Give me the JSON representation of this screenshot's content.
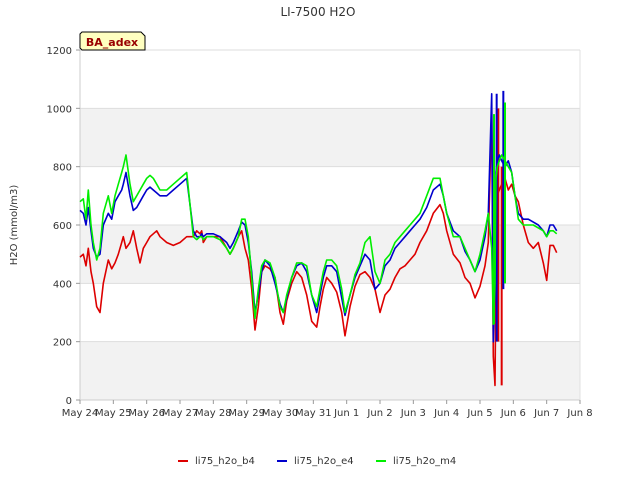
{
  "chart_data": {
    "type": "line",
    "title": "LI-7500 H2O",
    "ylabel": "H2O (mmol/m3)",
    "xlabel": "",
    "site_badge": "BA_adex",
    "x_ticks": [
      "May 24",
      "May 25",
      "May 26",
      "May 27",
      "May 28",
      "May 29",
      "May 30",
      "May 31",
      "Jun 1",
      "Jun 2",
      "Jun 3",
      "Jun 4",
      "Jun 5",
      "Jun 6",
      "Jun 7",
      "Jun 8"
    ],
    "y_ticks": [
      0,
      200,
      400,
      600,
      800,
      1000,
      1200
    ],
    "xlim": [
      0,
      15
    ],
    "ylim": [
      0,
      1200
    ],
    "grid": "horizontal bands",
    "legend_position": "bottom",
    "series": [
      {
        "name": "li75_h2o_b4",
        "color": "#dd0000",
        "x": [
          0.0,
          0.1,
          0.18,
          0.25,
          0.33,
          0.4,
          0.5,
          0.6,
          0.7,
          0.85,
          0.95,
          1.05,
          1.15,
          1.25,
          1.3,
          1.38,
          1.5,
          1.6,
          1.7,
          1.8,
          1.9,
          2.0,
          2.1,
          2.2,
          2.3,
          2.4,
          2.6,
          2.8,
          3.0,
          3.2,
          3.4,
          3.5,
          3.6,
          3.65,
          3.7,
          3.8,
          4.0,
          4.2,
          4.4,
          4.5,
          4.6,
          4.75,
          4.85,
          4.95,
          5.05,
          5.15,
          5.25,
          5.35,
          5.45,
          5.55,
          5.7,
          5.85,
          6.0,
          6.1,
          6.2,
          6.35,
          6.5,
          6.65,
          6.8,
          6.95,
          7.1,
          7.2,
          7.3,
          7.4,
          7.55,
          7.7,
          7.85,
          7.95,
          8.1,
          8.25,
          8.4,
          8.55,
          8.7,
          8.85,
          9.0,
          9.15,
          9.3,
          9.45,
          9.6,
          9.75,
          9.9,
          10.05,
          10.2,
          10.4,
          10.6,
          10.8,
          10.9,
          11.0,
          11.2,
          11.4,
          11.55,
          11.7,
          11.85,
          12.0,
          12.15,
          12.25,
          12.35,
          12.4,
          12.45,
          12.48,
          12.52,
          12.58,
          12.65,
          12.75,
          12.85,
          12.95,
          13.05,
          13.15,
          13.3,
          13.45,
          13.6,
          13.75,
          13.9,
          14.0,
          14.1,
          14.2,
          14.3
        ],
        "y": [
          490,
          500,
          460,
          520,
          440,
          400,
          320,
          300,
          400,
          480,
          450,
          470,
          500,
          540,
          560,
          520,
          540,
          580,
          520,
          470,
          520,
          540,
          560,
          570,
          580,
          560,
          540,
          530,
          540,
          560,
          560,
          580,
          570,
          580,
          540,
          560,
          560,
          560,
          520,
          500,
          520,
          560,
          580,
          520,
          480,
          380,
          240,
          320,
          440,
          460,
          450,
          420,
          300,
          260,
          340,
          400,
          440,
          420,
          360,
          270,
          250,
          320,
          380,
          420,
          400,
          370,
          300,
          220,
          320,
          390,
          430,
          440,
          420,
          380,
          300,
          360,
          380,
          420,
          450,
          460,
          480,
          500,
          540,
          580,
          640,
          670,
          640,
          580,
          500,
          470,
          420,
          400,
          350,
          390,
          460,
          540,
          1000,
          150,
          50,
          440,
          700,
          720,
          740,
          760,
          720,
          740,
          700,
          680,
          600,
          540,
          520,
          540,
          470,
          410,
          530,
          530,
          505
        ],
        "spikes": [
          [
            12.55,
            200,
            1000
          ],
          [
            12.65,
            50,
            800
          ]
        ]
      },
      {
        "name": "li75_h2o_e4",
        "color": "#0000cc",
        "x": [
          0.0,
          0.1,
          0.18,
          0.25,
          0.33,
          0.4,
          0.5,
          0.6,
          0.7,
          0.85,
          0.95,
          1.05,
          1.15,
          1.25,
          1.3,
          1.38,
          1.5,
          1.6,
          1.7,
          1.8,
          1.9,
          2.0,
          2.1,
          2.2,
          2.3,
          2.4,
          2.6,
          2.8,
          3.0,
          3.2,
          3.4,
          3.5,
          3.6,
          3.65,
          3.7,
          3.8,
          4.0,
          4.2,
          4.4,
          4.5,
          4.6,
          4.75,
          4.85,
          4.95,
          5.05,
          5.15,
          5.25,
          5.35,
          5.45,
          5.55,
          5.7,
          5.85,
          6.0,
          6.1,
          6.2,
          6.35,
          6.5,
          6.65,
          6.8,
          6.95,
          7.1,
          7.2,
          7.3,
          7.4,
          7.55,
          7.7,
          7.85,
          7.95,
          8.1,
          8.25,
          8.4,
          8.55,
          8.7,
          8.85,
          9.0,
          9.15,
          9.3,
          9.45,
          9.6,
          9.75,
          9.9,
          10.05,
          10.2,
          10.4,
          10.6,
          10.8,
          10.9,
          11.0,
          11.2,
          11.4,
          11.55,
          11.7,
          11.85,
          12.0,
          12.15,
          12.25,
          12.35,
          12.4,
          12.45,
          12.48,
          12.52,
          12.58,
          12.65,
          12.75,
          12.85,
          12.95,
          13.05,
          13.15,
          13.3,
          13.45,
          13.6,
          13.75,
          13.9,
          14.0,
          14.1,
          14.2,
          14.3
        ],
        "y": [
          650,
          640,
          600,
          660,
          580,
          520,
          490,
          500,
          600,
          640,
          620,
          680,
          700,
          720,
          740,
          780,
          700,
          650,
          660,
          680,
          700,
          720,
          730,
          720,
          710,
          700,
          700,
          720,
          740,
          760,
          580,
          560,
          560,
          570,
          560,
          570,
          570,
          560,
          540,
          520,
          540,
          580,
          610,
          600,
          540,
          440,
          300,
          360,
          440,
          480,
          460,
          400,
          330,
          300,
          350,
          420,
          460,
          470,
          440,
          360,
          300,
          360,
          420,
          460,
          460,
          440,
          350,
          290,
          360,
          420,
          460,
          500,
          480,
          380,
          400,
          460,
          480,
          520,
          540,
          560,
          580,
          600,
          620,
          660,
          720,
          740,
          700,
          640,
          580,
          560,
          510,
          480,
          440,
          480,
          560,
          640,
          1050,
          200,
          420,
          780,
          820,
          840,
          820,
          800,
          820,
          780,
          700,
          640,
          620,
          620,
          610,
          600,
          580,
          560,
          600,
          600,
          580
        ],
        "spikes": [
          [
            12.5,
            200,
            1050
          ],
          [
            12.7,
            380,
            1060
          ]
        ]
      },
      {
        "name": "li75_h2o_m4",
        "color": "#00ee00",
        "x": [
          0.0,
          0.1,
          0.18,
          0.25,
          0.33,
          0.4,
          0.5,
          0.6,
          0.7,
          0.85,
          0.95,
          1.05,
          1.15,
          1.25,
          1.3,
          1.38,
          1.5,
          1.6,
          1.7,
          1.8,
          1.9,
          2.0,
          2.1,
          2.2,
          2.3,
          2.4,
          2.6,
          2.8,
          3.0,
          3.2,
          3.4,
          3.5,
          3.6,
          3.65,
          3.7,
          3.8,
          4.0,
          4.2,
          4.4,
          4.5,
          4.6,
          4.75,
          4.85,
          4.95,
          5.05,
          5.15,
          5.25,
          5.35,
          5.45,
          5.55,
          5.7,
          5.85,
          6.0,
          6.1,
          6.2,
          6.35,
          6.5,
          6.65,
          6.8,
          6.95,
          7.1,
          7.2,
          7.3,
          7.4,
          7.55,
          7.7,
          7.85,
          7.95,
          8.1,
          8.25,
          8.4,
          8.55,
          8.7,
          8.85,
          9.0,
          9.15,
          9.3,
          9.45,
          9.6,
          9.75,
          9.9,
          10.05,
          10.2,
          10.4,
          10.6,
          10.8,
          10.9,
          11.0,
          11.2,
          11.4,
          11.55,
          11.7,
          11.85,
          12.0,
          12.15,
          12.25,
          12.35,
          12.4,
          12.45,
          12.48,
          12.52,
          12.58,
          12.65,
          12.75,
          12.85,
          12.95,
          13.05,
          13.15,
          13.3,
          13.45,
          13.6,
          13.75,
          13.9,
          14.0,
          14.1,
          14.2,
          14.3
        ],
        "y": [
          680,
          690,
          620,
          720,
          600,
          540,
          480,
          520,
          640,
          700,
          640,
          700,
          740,
          780,
          800,
          840,
          740,
          680,
          700,
          720,
          740,
          760,
          770,
          760,
          740,
          720,
          720,
          740,
          760,
          780,
          560,
          550,
          560,
          560,
          550,
          560,
          560,
          550,
          520,
          500,
          520,
          560,
          620,
          620,
          560,
          420,
          280,
          380,
          460,
          480,
          470,
          420,
          320,
          300,
          360,
          420,
          470,
          470,
          460,
          360,
          320,
          380,
          440,
          480,
          480,
          460,
          380,
          300,
          360,
          430,
          470,
          540,
          560,
          440,
          400,
          480,
          500,
          540,
          560,
          580,
          600,
          620,
          640,
          700,
          760,
          760,
          700,
          640,
          560,
          560,
          520,
          480,
          440,
          500,
          580,
          640,
          520,
          260,
          400,
          760,
          800,
          820,
          840,
          820,
          800,
          780,
          700,
          620,
          600,
          600,
          600,
          590,
          580,
          560,
          580,
          580,
          570
        ],
        "spikes": [
          [
            12.42,
            260,
            980
          ],
          [
            12.75,
            400,
            1020
          ]
        ]
      }
    ]
  }
}
